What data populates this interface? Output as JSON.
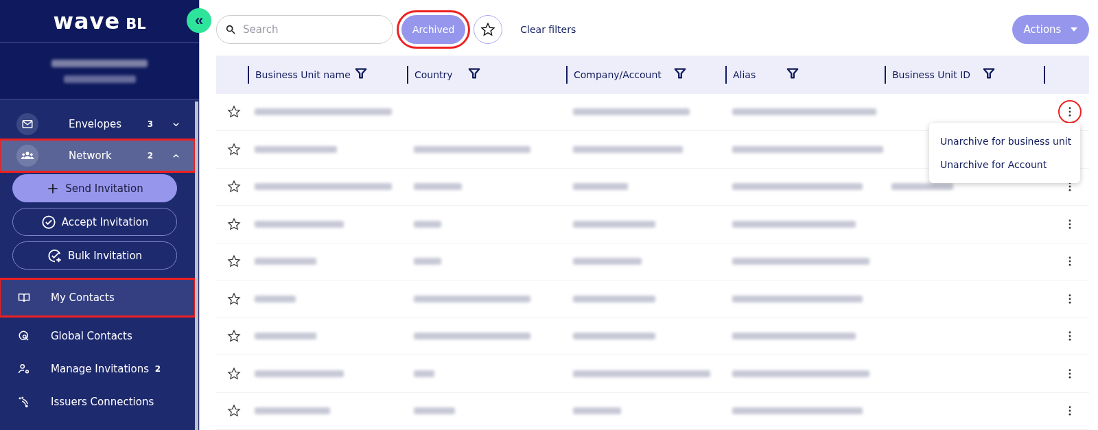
{
  "sidebar": {
    "logo": {
      "main": "wave",
      "suffix": "BL"
    },
    "collapse_button": "«",
    "nav": [
      {
        "kind": "group",
        "label": "Envelopes",
        "count": "3",
        "expanded": false,
        "selected": false,
        "annotated": false
      },
      {
        "kind": "group",
        "label": "Network",
        "count": "2",
        "expanded": true,
        "selected": true,
        "annotated": true
      },
      {
        "kind": "button",
        "label": "Send Invitation",
        "primary": true
      },
      {
        "kind": "button",
        "label": "Accept Invitation",
        "primary": false
      },
      {
        "kind": "button",
        "label": "Bulk Invitation",
        "primary": false
      },
      {
        "kind": "item",
        "label": "My Contacts",
        "selected": true,
        "annotated": true
      },
      {
        "kind": "item",
        "label": "Global Contacts",
        "selected": false,
        "annotated": false
      },
      {
        "kind": "item",
        "label": "Manage Invitations",
        "count": "2",
        "selected": false,
        "annotated": false
      },
      {
        "kind": "item",
        "label": "Issuers Connections",
        "selected": false,
        "annotated": false
      }
    ]
  },
  "toolbar": {
    "search": {
      "placeholder": "Search"
    },
    "archived": {
      "label": "Archived",
      "selected": true,
      "annotated": true
    },
    "favorites_filter": {
      "selected": false
    },
    "clear_filters": "Clear filters",
    "actions": "Actions"
  },
  "table": {
    "columns": [
      "Business Unit name",
      "Country",
      "Company/Account",
      "Alias",
      "Business Unit ID"
    ],
    "rows": [
      {
        "starred": false,
        "menu_open": true,
        "cells": [
          {
            "blurred": true
          },
          {
            "blurred": false
          },
          {
            "blurred": true
          },
          {
            "blurred": true
          },
          {
            "blurred": false
          }
        ]
      },
      {
        "starred": false,
        "menu_open": false,
        "cells": [
          {
            "blurred": true
          },
          {
            "blurred": true
          },
          {
            "blurred": true
          },
          {
            "blurred": true
          },
          {
            "blurred": false
          }
        ]
      },
      {
        "starred": false,
        "menu_open": false,
        "cells": [
          {
            "blurred": true
          },
          {
            "blurred": true
          },
          {
            "blurred": true
          },
          {
            "blurred": true
          },
          {
            "blurred": true
          }
        ]
      },
      {
        "starred": false,
        "menu_open": false,
        "cells": [
          {
            "blurred": true
          },
          {
            "blurred": true
          },
          {
            "blurred": true
          },
          {
            "blurred": true
          },
          {
            "blurred": false
          }
        ]
      },
      {
        "starred": false,
        "menu_open": false,
        "cells": [
          {
            "blurred": true
          },
          {
            "blurred": true
          },
          {
            "blurred": true
          },
          {
            "blurred": true
          },
          {
            "blurred": false
          }
        ]
      },
      {
        "starred": false,
        "menu_open": false,
        "cells": [
          {
            "blurred": true
          },
          {
            "blurred": true
          },
          {
            "blurred": true
          },
          {
            "blurred": true
          },
          {
            "blurred": false
          }
        ]
      },
      {
        "starred": false,
        "menu_open": false,
        "cells": [
          {
            "blurred": true
          },
          {
            "blurred": true
          },
          {
            "blurred": true
          },
          {
            "blurred": true
          },
          {
            "blurred": false
          }
        ]
      },
      {
        "starred": false,
        "menu_open": false,
        "cells": [
          {
            "blurred": true
          },
          {
            "blurred": true
          },
          {
            "blurred": true
          },
          {
            "blurred": true
          },
          {
            "blurred": false
          }
        ]
      },
      {
        "starred": false,
        "menu_open": false,
        "cells": [
          {
            "blurred": true
          },
          {
            "blurred": true
          },
          {
            "blurred": true
          },
          {
            "blurred": true
          },
          {
            "blurred": false
          }
        ]
      }
    ]
  },
  "row_menu": {
    "button_annotated": true,
    "items": [
      "Unarchive for business unit",
      "Unarchive for Account"
    ]
  }
}
